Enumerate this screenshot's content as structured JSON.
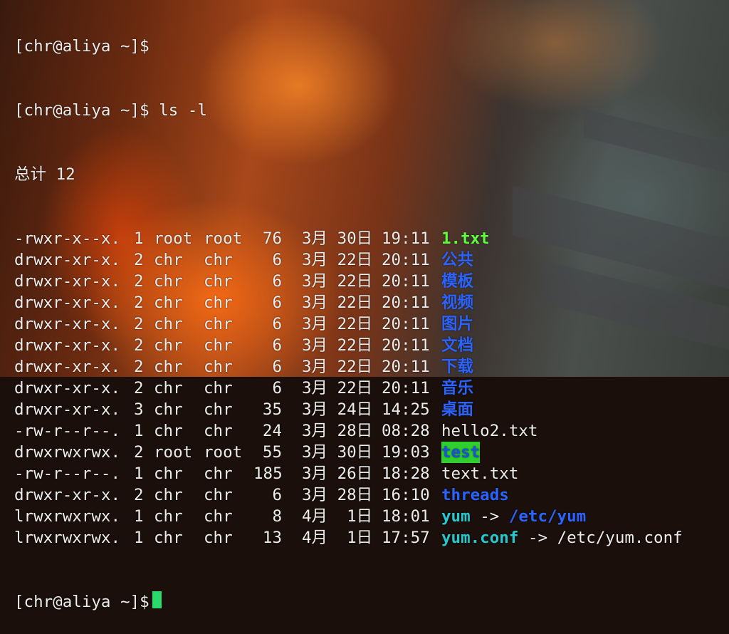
{
  "terminal": {
    "prev_prompt": "[chr@aliya ~]$",
    "prompt": "[chr@aliya ~]$",
    "command": "ls -l",
    "total": "总计 12",
    "rows": [
      {
        "perm": "-rwxr-x--x.",
        "links": "1",
        "owner": "root",
        "group": "root",
        "size": "76",
        "date": "3月 30日",
        "time": "19:11",
        "name": "1.txt",
        "type": "exec",
        "target": ""
      },
      {
        "perm": "drwxr-xr-x.",
        "links": "2",
        "owner": "chr",
        "group": "chr",
        "size": "6",
        "date": "3月 22日",
        "time": "20:11",
        "name": "公共",
        "type": "dir",
        "target": ""
      },
      {
        "perm": "drwxr-xr-x.",
        "links": "2",
        "owner": "chr",
        "group": "chr",
        "size": "6",
        "date": "3月 22日",
        "time": "20:11",
        "name": "模板",
        "type": "dir",
        "target": ""
      },
      {
        "perm": "drwxr-xr-x.",
        "links": "2",
        "owner": "chr",
        "group": "chr",
        "size": "6",
        "date": "3月 22日",
        "time": "20:11",
        "name": "视频",
        "type": "dir",
        "target": ""
      },
      {
        "perm": "drwxr-xr-x.",
        "links": "2",
        "owner": "chr",
        "group": "chr",
        "size": "6",
        "date": "3月 22日",
        "time": "20:11",
        "name": "图片",
        "type": "dir",
        "target": ""
      },
      {
        "perm": "drwxr-xr-x.",
        "links": "2",
        "owner": "chr",
        "group": "chr",
        "size": "6",
        "date": "3月 22日",
        "time": "20:11",
        "name": "文档",
        "type": "dir",
        "target": ""
      },
      {
        "perm": "drwxr-xr-x.",
        "links": "2",
        "owner": "chr",
        "group": "chr",
        "size": "6",
        "date": "3月 22日",
        "time": "20:11",
        "name": "下载",
        "type": "dir",
        "target": ""
      },
      {
        "perm": "drwxr-xr-x.",
        "links": "2",
        "owner": "chr",
        "group": "chr",
        "size": "6",
        "date": "3月 22日",
        "time": "20:11",
        "name": "音乐",
        "type": "dir",
        "target": ""
      },
      {
        "perm": "drwxr-xr-x.",
        "links": "3",
        "owner": "chr",
        "group": "chr",
        "size": "35",
        "date": "3月 24日",
        "time": "14:25",
        "name": "桌面",
        "type": "dir",
        "target": ""
      },
      {
        "perm": "-rw-r--r--.",
        "links": "1",
        "owner": "chr",
        "group": "chr",
        "size": "24",
        "date": "3月 28日",
        "time": "08:28",
        "name": "hello2.txt",
        "type": "plain",
        "target": ""
      },
      {
        "perm": "drwxrwxrwx.",
        "links": "2",
        "owner": "root",
        "group": "root",
        "size": "55",
        "date": "3月 30日",
        "time": "19:03",
        "name": "test",
        "type": "dirhl",
        "target": ""
      },
      {
        "perm": "-rw-r--r--.",
        "links": "1",
        "owner": "chr",
        "group": "chr",
        "size": "185",
        "date": "3月 26日",
        "time": "18:28",
        "name": "text.txt",
        "type": "plain",
        "target": ""
      },
      {
        "perm": "drwxr-xr-x.",
        "links": "2",
        "owner": "chr",
        "group": "chr",
        "size": "6",
        "date": "3月 28日",
        "time": "16:10",
        "name": "threads",
        "type": "dir",
        "target": ""
      },
      {
        "perm": "lrwxrwxrwx.",
        "links": "1",
        "owner": "chr",
        "group": "chr",
        "size": "8",
        "date": "4月  1日",
        "time": "18:01",
        "name": "yum",
        "type": "link",
        "target": "/etc/yum"
      },
      {
        "perm": "lrwxrwxrwx.",
        "links": "1",
        "owner": "chr",
        "group": "chr",
        "size": "13",
        "date": "4月  1日",
        "time": "17:57",
        "name": "yum.conf",
        "type": "link",
        "target": "/etc/yum.conf"
      }
    ],
    "arrow": "->"
  },
  "colors": {
    "exec": "#5cff3a",
    "dir": "#2b63ff",
    "link": "#25c8d0",
    "cursor": "#2bd96b"
  }
}
